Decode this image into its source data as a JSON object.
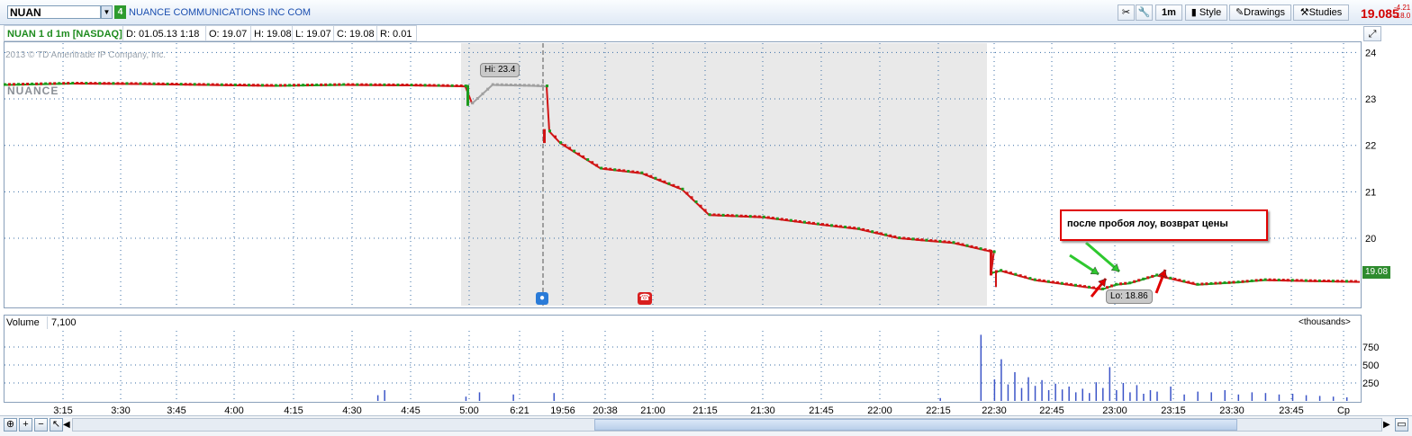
{
  "header": {
    "symbol": "NUAN",
    "link_number": "4",
    "company_name": "NUANCE COMMUNICATIONS INC COM",
    "toolbar_period": "1m",
    "style_label": "Style",
    "drawings_label": "Drawings",
    "studies_label": "Studies",
    "last_price": "19.085",
    "change_1": "-4.21",
    "change_2": "-18.0"
  },
  "infobar": {
    "title": "NUAN 1 d 1m [NASDAQ]",
    "date": "D: 01.05.13 1:18",
    "open": "O: 19.07",
    "high": "H: 19.08",
    "low": "L: 19.07",
    "close": "C: 19.08",
    "range": "R: 0.01"
  },
  "watermark": "2013 © TD Ameritrade IP Company, Inc.",
  "logo_text": "NUANCE",
  "annotation_text": "после пробоя лоу, возврат цены",
  "volume_pane": {
    "label": "Volume",
    "value": "7,100",
    "units": "<thousands>"
  },
  "colors": {
    "up": "#1e9b1e",
    "down": "#d01414",
    "premarket": "#a0a0a0",
    "grid": "#3a6ea5",
    "shade": "#e9e9e9",
    "volume": "#3c55c8",
    "alert_red": "#e00000",
    "arrow_green": "#2ec82e"
  },
  "chart_data": [
    {
      "type": "line",
      "title": "NUAN 1 d 1m [NASDAQ]",
      "y_ticks": [
        20,
        21,
        22,
        23,
        24
      ],
      "ylim": [
        18.55,
        24.2
      ],
      "x_ticks": [
        "3:15",
        "3:30",
        "3:45",
        "4:00",
        "4:15",
        "4:30",
        "4:45",
        "5:00",
        "6:21",
        "19:56",
        "20:38",
        "21:00",
        "21:15",
        "21:30",
        "21:45",
        "22:00",
        "22:15",
        "22:30",
        "22:45",
        "23:00",
        "23:15",
        "23:30",
        "23:45",
        "Ср"
      ],
      "annotations": {
        "high": "Hi: 23.4",
        "low": "Lo: 18.86",
        "last": "19.08"
      },
      "series": [
        {
          "name": "NUAN",
          "x": [
            0,
            0.05,
            0.1,
            0.15,
            0.2,
            0.25,
            0.3,
            0.34,
            0.345,
            0.36,
            0.39,
            0.4,
            0.402,
            0.41,
            0.44,
            0.47,
            0.5,
            0.52,
            0.56,
            0.6,
            0.63,
            0.66,
            0.7,
            0.73,
            0.728,
            0.735,
            0.76,
            0.79,
            0.81,
            0.82,
            0.83,
            0.85,
            0.88,
            0.91,
            0.93,
            0.96,
            1.0
          ],
          "values": [
            23.3,
            23.33,
            23.32,
            23.3,
            23.28,
            23.3,
            23.29,
            23.27,
            22.9,
            23.3,
            23.28,
            23.27,
            22.3,
            22.05,
            21.5,
            21.4,
            21.05,
            20.5,
            20.45,
            20.3,
            20.2,
            20.0,
            19.9,
            19.7,
            19.25,
            19.3,
            19.1,
            18.98,
            18.9,
            19.0,
            19.03,
            19.2,
            19.0,
            19.05,
            19.1,
            19.08,
            19.06
          ]
        }
      ]
    },
    {
      "type": "bar",
      "title": "Volume",
      "y_ticks": [
        250,
        500,
        750
      ],
      "ylim": [
        0,
        950
      ],
      "x": [
        0.275,
        0.28,
        0.34,
        0.35,
        0.375,
        0.405,
        0.69,
        0.72,
        0.73,
        0.735,
        0.74,
        0.745,
        0.75,
        0.755,
        0.76,
        0.765,
        0.77,
        0.775,
        0.78,
        0.785,
        0.79,
        0.795,
        0.8,
        0.805,
        0.81,
        0.815,
        0.82,
        0.825,
        0.83,
        0.835,
        0.84,
        0.845,
        0.85,
        0.86,
        0.87,
        0.88,
        0.89,
        0.9,
        0.91,
        0.92,
        0.93,
        0.94,
        0.95,
        0.96,
        0.97,
        0.98,
        0.99
      ],
      "values": [
        80,
        150,
        60,
        120,
        90,
        110,
        40,
        920,
        300,
        580,
        230,
        400,
        180,
        330,
        210,
        290,
        150,
        240,
        160,
        200,
        120,
        170,
        110,
        260,
        180,
        470,
        150,
        250,
        120,
        220,
        100,
        150,
        130,
        200,
        90,
        130,
        120,
        150,
        90,
        120,
        110,
        90,
        100,
        80,
        70,
        60,
        50
      ]
    }
  ]
}
